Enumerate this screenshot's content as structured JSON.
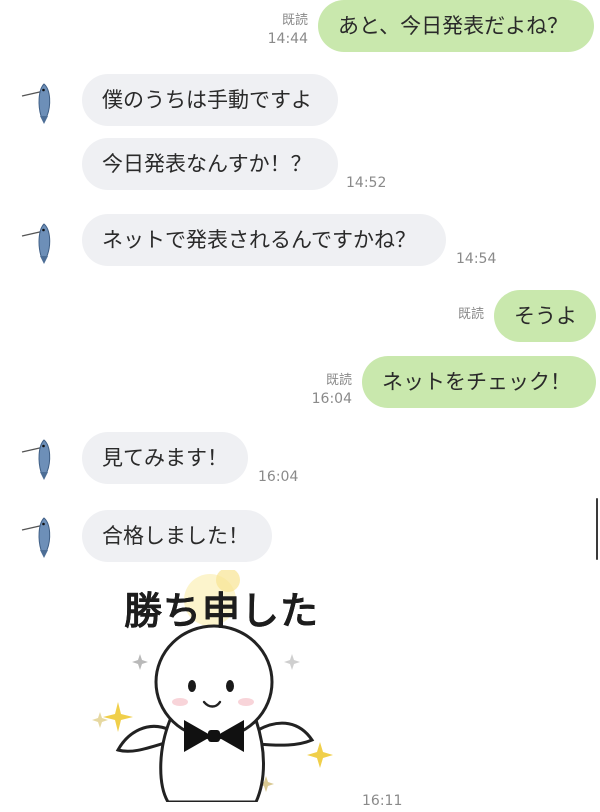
{
  "messages": [
    {
      "side": "out",
      "text": "あと、今日発表だよね？",
      "read": "既読",
      "time": "14:44"
    },
    {
      "side": "in",
      "text": "僕のうちは手動ですよ",
      "time": ""
    },
    {
      "side": "in",
      "text": "今日発表なんすか！？",
      "time": "14:52"
    },
    {
      "side": "in",
      "text": "ネットで発表されるんですかね？",
      "time": "14:54"
    },
    {
      "side": "out",
      "text": "そうよ",
      "read": "既読",
      "time": ""
    },
    {
      "side": "out",
      "text": "ネットをチェック！",
      "read": "既読",
      "time": "16:04"
    },
    {
      "side": "in",
      "text": "見てみます！",
      "time": "16:04"
    },
    {
      "side": "in",
      "text": "合格しました！",
      "time": ""
    }
  ],
  "sticker": {
    "caption": "勝ち申した",
    "time": "16:11",
    "name": "sticker-katimoushita"
  },
  "avatar": {
    "icon": "fish-icon"
  },
  "colors": {
    "incoming_bubble": "#eff0f3",
    "outgoing_bubble": "#c9e8ad",
    "meta": "#8a8a8a"
  }
}
